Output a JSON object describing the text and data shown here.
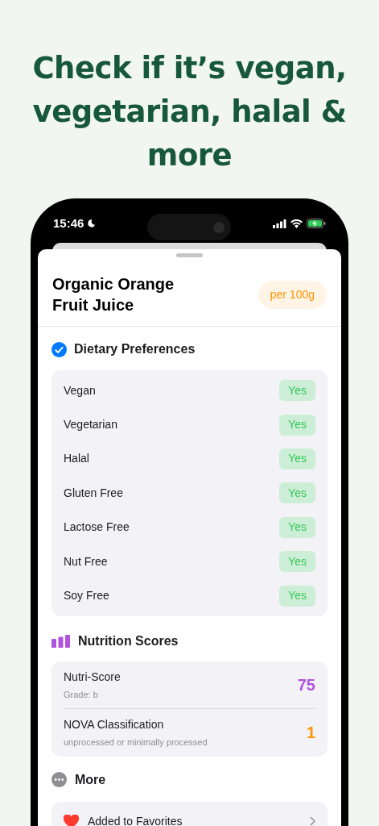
{
  "headline": "Check if it’s vegan, vegetarian, halal & more",
  "status_bar": {
    "time": "15:46"
  },
  "product": {
    "name": "Organic Orange Fruit Juice",
    "basis": "per 100g"
  },
  "dietary": {
    "title": "Dietary Preferences",
    "items": [
      {
        "label": "Vegan",
        "value": "Yes"
      },
      {
        "label": "Vegetarian",
        "value": "Yes"
      },
      {
        "label": "Halal",
        "value": "Yes"
      },
      {
        "label": "Gluten Free",
        "value": "Yes"
      },
      {
        "label": "Lactose Free",
        "value": "Yes"
      },
      {
        "label": "Nut Free",
        "value": "Yes"
      },
      {
        "label": "Soy Free",
        "value": "Yes"
      }
    ]
  },
  "scores": {
    "title": "Nutrition Scores",
    "items": [
      {
        "label": "Nutri-Score",
        "detail": "Grade: b",
        "value": "75",
        "color": "#af52de"
      },
      {
        "label": "NOVA Classification",
        "detail": "unprocessed or minimally processed",
        "value": "1",
        "color": "#ff9500"
      }
    ]
  },
  "more": {
    "title": "More",
    "items": [
      {
        "label": "Added to Favorites"
      }
    ]
  }
}
